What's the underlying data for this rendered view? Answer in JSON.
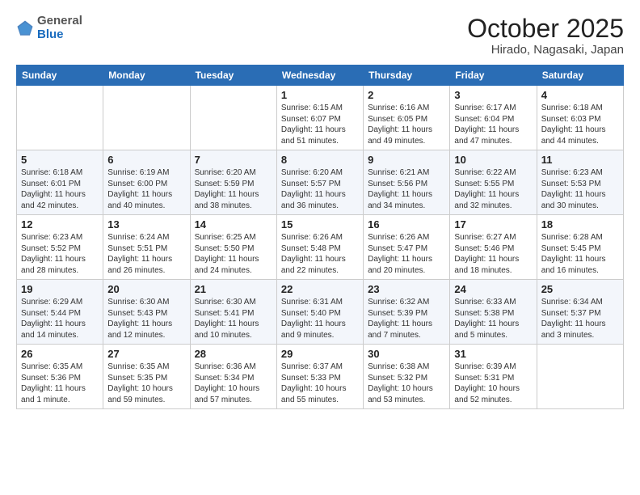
{
  "header": {
    "logo_general": "General",
    "logo_blue": "Blue",
    "month": "October 2025",
    "location": "Hirado, Nagasaki, Japan"
  },
  "days_of_week": [
    "Sunday",
    "Monday",
    "Tuesday",
    "Wednesday",
    "Thursday",
    "Friday",
    "Saturday"
  ],
  "weeks": [
    [
      {
        "day": "",
        "info": ""
      },
      {
        "day": "",
        "info": ""
      },
      {
        "day": "",
        "info": ""
      },
      {
        "day": "1",
        "info": "Sunrise: 6:15 AM\nSunset: 6:07 PM\nDaylight: 11 hours\nand 51 minutes."
      },
      {
        "day": "2",
        "info": "Sunrise: 6:16 AM\nSunset: 6:05 PM\nDaylight: 11 hours\nand 49 minutes."
      },
      {
        "day": "3",
        "info": "Sunrise: 6:17 AM\nSunset: 6:04 PM\nDaylight: 11 hours\nand 47 minutes."
      },
      {
        "day": "4",
        "info": "Sunrise: 6:18 AM\nSunset: 6:03 PM\nDaylight: 11 hours\nand 44 minutes."
      }
    ],
    [
      {
        "day": "5",
        "info": "Sunrise: 6:18 AM\nSunset: 6:01 PM\nDaylight: 11 hours\nand 42 minutes."
      },
      {
        "day": "6",
        "info": "Sunrise: 6:19 AM\nSunset: 6:00 PM\nDaylight: 11 hours\nand 40 minutes."
      },
      {
        "day": "7",
        "info": "Sunrise: 6:20 AM\nSunset: 5:59 PM\nDaylight: 11 hours\nand 38 minutes."
      },
      {
        "day": "8",
        "info": "Sunrise: 6:20 AM\nSunset: 5:57 PM\nDaylight: 11 hours\nand 36 minutes."
      },
      {
        "day": "9",
        "info": "Sunrise: 6:21 AM\nSunset: 5:56 PM\nDaylight: 11 hours\nand 34 minutes."
      },
      {
        "day": "10",
        "info": "Sunrise: 6:22 AM\nSunset: 5:55 PM\nDaylight: 11 hours\nand 32 minutes."
      },
      {
        "day": "11",
        "info": "Sunrise: 6:23 AM\nSunset: 5:53 PM\nDaylight: 11 hours\nand 30 minutes."
      }
    ],
    [
      {
        "day": "12",
        "info": "Sunrise: 6:23 AM\nSunset: 5:52 PM\nDaylight: 11 hours\nand 28 minutes."
      },
      {
        "day": "13",
        "info": "Sunrise: 6:24 AM\nSunset: 5:51 PM\nDaylight: 11 hours\nand 26 minutes."
      },
      {
        "day": "14",
        "info": "Sunrise: 6:25 AM\nSunset: 5:50 PM\nDaylight: 11 hours\nand 24 minutes."
      },
      {
        "day": "15",
        "info": "Sunrise: 6:26 AM\nSunset: 5:48 PM\nDaylight: 11 hours\nand 22 minutes."
      },
      {
        "day": "16",
        "info": "Sunrise: 6:26 AM\nSunset: 5:47 PM\nDaylight: 11 hours\nand 20 minutes."
      },
      {
        "day": "17",
        "info": "Sunrise: 6:27 AM\nSunset: 5:46 PM\nDaylight: 11 hours\nand 18 minutes."
      },
      {
        "day": "18",
        "info": "Sunrise: 6:28 AM\nSunset: 5:45 PM\nDaylight: 11 hours\nand 16 minutes."
      }
    ],
    [
      {
        "day": "19",
        "info": "Sunrise: 6:29 AM\nSunset: 5:44 PM\nDaylight: 11 hours\nand 14 minutes."
      },
      {
        "day": "20",
        "info": "Sunrise: 6:30 AM\nSunset: 5:43 PM\nDaylight: 11 hours\nand 12 minutes."
      },
      {
        "day": "21",
        "info": "Sunrise: 6:30 AM\nSunset: 5:41 PM\nDaylight: 11 hours\nand 10 minutes."
      },
      {
        "day": "22",
        "info": "Sunrise: 6:31 AM\nSunset: 5:40 PM\nDaylight: 11 hours\nand 9 minutes."
      },
      {
        "day": "23",
        "info": "Sunrise: 6:32 AM\nSunset: 5:39 PM\nDaylight: 11 hours\nand 7 minutes."
      },
      {
        "day": "24",
        "info": "Sunrise: 6:33 AM\nSunset: 5:38 PM\nDaylight: 11 hours\nand 5 minutes."
      },
      {
        "day": "25",
        "info": "Sunrise: 6:34 AM\nSunset: 5:37 PM\nDaylight: 11 hours\nand 3 minutes."
      }
    ],
    [
      {
        "day": "26",
        "info": "Sunrise: 6:35 AM\nSunset: 5:36 PM\nDaylight: 11 hours\nand 1 minute."
      },
      {
        "day": "27",
        "info": "Sunrise: 6:35 AM\nSunset: 5:35 PM\nDaylight: 10 hours\nand 59 minutes."
      },
      {
        "day": "28",
        "info": "Sunrise: 6:36 AM\nSunset: 5:34 PM\nDaylight: 10 hours\nand 57 minutes."
      },
      {
        "day": "29",
        "info": "Sunrise: 6:37 AM\nSunset: 5:33 PM\nDaylight: 10 hours\nand 55 minutes."
      },
      {
        "day": "30",
        "info": "Sunrise: 6:38 AM\nSunset: 5:32 PM\nDaylight: 10 hours\nand 53 minutes."
      },
      {
        "day": "31",
        "info": "Sunrise: 6:39 AM\nSunset: 5:31 PM\nDaylight: 10 hours\nand 52 minutes."
      },
      {
        "day": "",
        "info": ""
      }
    ]
  ]
}
